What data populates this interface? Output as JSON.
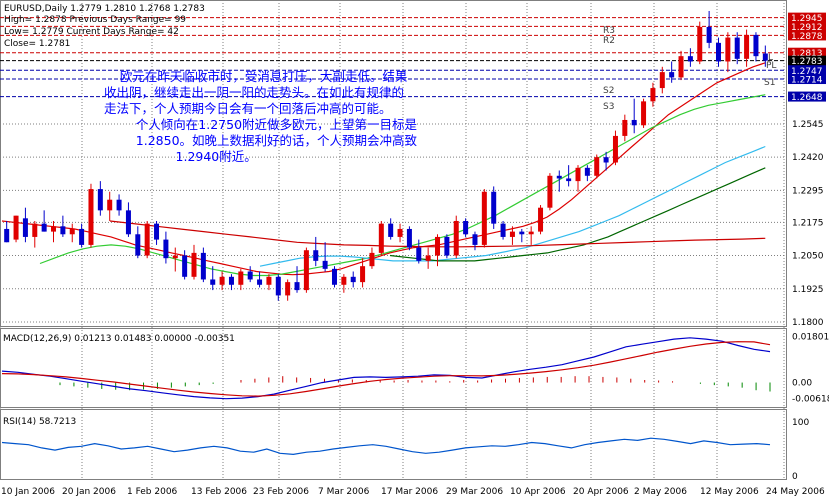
{
  "chart_data": [
    {
      "type": "candlestick",
      "title": "EURUSD,Daily  1.2779 1.2810 1.2768 1.2783",
      "info_lines": [
        "High= 1.2878     Previous Days Range= 99",
        "Low= 1.2779     Current Days Range= 42",
        "Close= 1.2781"
      ],
      "ylim": [
        1.18,
        1.3
      ],
      "y_ticks": [
        "1.2545",
        "1.2420",
        "1.2295",
        "1.2175",
        "1.2050",
        "1.1925",
        "1.1800"
      ],
      "x_ticks": [
        "10 Jan 2006",
        "20 Jan 2006",
        "1 Feb 2006",
        "13 Feb 2006",
        "23 Feb 2006",
        "7 Mar 2006",
        "17 Mar 2006",
        "29 Mar 2006",
        "10 Apr 2006",
        "20 Apr 2006",
        "2 May 2006",
        "12 May 2006",
        "24 May 2006"
      ],
      "candles": [
        [
          1.215,
          1.218,
          1.21,
          1.21
        ],
        [
          1.211,
          1.22,
          1.21,
          1.22
        ],
        [
          1.219,
          1.223,
          1.21,
          1.212
        ],
        [
          1.212,
          1.218,
          1.208,
          1.217
        ],
        [
          1.217,
          1.222,
          1.214,
          1.214
        ],
        [
          1.214,
          1.218,
          1.21,
          1.216
        ],
        [
          1.216,
          1.22,
          1.212,
          1.213
        ],
        [
          1.213,
          1.217,
          1.21,
          1.215
        ],
        [
          1.215,
          1.217,
          1.208,
          1.209
        ],
        [
          1.209,
          1.232,
          1.208,
          1.23
        ],
        [
          1.23,
          1.233,
          1.22,
          1.222
        ],
        [
          1.222,
          1.229,
          1.218,
          1.226
        ],
        [
          1.226,
          1.228,
          1.22,
          1.222
        ],
        [
          1.222,
          1.225,
          1.212,
          1.213
        ],
        [
          1.213,
          1.216,
          1.204,
          1.205
        ],
        [
          1.205,
          1.218,
          1.204,
          1.217
        ],
        [
          1.217,
          1.218,
          1.209,
          1.211
        ],
        [
          1.211,
          1.214,
          1.202,
          1.204
        ],
        [
          1.204,
          1.208,
          1.199,
          1.205
        ],
        [
          1.205,
          1.207,
          1.196,
          1.197
        ],
        [
          1.197,
          1.209,
          1.196,
          1.206
        ],
        [
          1.206,
          1.208,
          1.195,
          1.196
        ],
        [
          1.196,
          1.201,
          1.192,
          1.194
        ],
        [
          1.194,
          1.199,
          1.192,
          1.197
        ],
        [
          1.197,
          1.198,
          1.192,
          1.194
        ],
        [
          1.194,
          1.2,
          1.192,
          1.199
        ],
        [
          1.199,
          1.201,
          1.195,
          1.196
        ],
        [
          1.196,
          1.199,
          1.193,
          1.194
        ],
        [
          1.194,
          1.198,
          1.192,
          1.197
        ],
        [
          1.197,
          1.198,
          1.188,
          1.19
        ],
        [
          1.19,
          1.196,
          1.188,
          1.195
        ],
        [
          1.195,
          1.201,
          1.191,
          1.192
        ],
        [
          1.192,
          1.208,
          1.191,
          1.207
        ],
        [
          1.207,
          1.212,
          1.201,
          1.203
        ],
        [
          1.203,
          1.21,
          1.199,
          1.2
        ],
        [
          1.2,
          1.201,
          1.193,
          1.194
        ],
        [
          1.194,
          1.198,
          1.191,
          1.197
        ],
        [
          1.197,
          1.199,
          1.193,
          1.195
        ],
        [
          1.195,
          1.204,
          1.193,
          1.201
        ],
        [
          1.201,
          1.208,
          1.2,
          1.206
        ],
        [
          1.206,
          1.218,
          1.205,
          1.217
        ],
        [
          1.217,
          1.219,
          1.211,
          1.212
        ],
        [
          1.212,
          1.217,
          1.21,
          1.215
        ],
        [
          1.215,
          1.216,
          1.207,
          1.208
        ],
        [
          1.208,
          1.211,
          1.202,
          1.203
        ],
        [
          1.203,
          1.208,
          1.2,
          1.205
        ],
        [
          1.205,
          1.213,
          1.201,
          1.212
        ],
        [
          1.212,
          1.213,
          1.204,
          1.205
        ],
        [
          1.205,
          1.22,
          1.204,
          1.218
        ],
        [
          1.218,
          1.219,
          1.212,
          1.213
        ],
        [
          1.213,
          1.214,
          1.207,
          1.209
        ],
        [
          1.209,
          1.23,
          1.208,
          1.229
        ],
        [
          1.229,
          1.231,
          1.215,
          1.217
        ],
        [
          1.217,
          1.218,
          1.211,
          1.212
        ],
        [
          1.212,
          1.216,
          1.209,
          1.214
        ],
        [
          1.214,
          1.215,
          1.21,
          1.213
        ],
        [
          1.213,
          1.216,
          1.209,
          1.214
        ],
        [
          1.214,
          1.224,
          1.213,
          1.223
        ],
        [
          1.223,
          1.236,
          1.222,
          1.235
        ],
        [
          1.235,
          1.237,
          1.229,
          1.234
        ],
        [
          1.234,
          1.239,
          1.231,
          1.233
        ],
        [
          1.233,
          1.239,
          1.229,
          1.238
        ],
        [
          1.238,
          1.239,
          1.233,
          1.235
        ],
        [
          1.235,
          1.243,
          1.234,
          1.242
        ],
        [
          1.242,
          1.244,
          1.237,
          1.24
        ],
        [
          1.24,
          1.252,
          1.239,
          1.25
        ],
        [
          1.25,
          1.258,
          1.248,
          1.256
        ],
        [
          1.256,
          1.264,
          1.251,
          1.254
        ],
        [
          1.254,
          1.264,
          1.253,
          1.263
        ],
        [
          1.263,
          1.27,
          1.261,
          1.268
        ],
        [
          1.268,
          1.276,
          1.266,
          1.274
        ],
        [
          1.274,
          1.278,
          1.27,
          1.272
        ],
        [
          1.272,
          1.282,
          1.271,
          1.28
        ],
        [
          1.28,
          1.283,
          1.276,
          1.278
        ],
        [
          1.278,
          1.293,
          1.277,
          1.291
        ],
        [
          1.291,
          1.297,
          1.283,
          1.285
        ],
        [
          1.285,
          1.287,
          1.276,
          1.278
        ],
        [
          1.278,
          1.289,
          1.274,
          1.287
        ],
        [
          1.287,
          1.289,
          1.277,
          1.279
        ],
        [
          1.279,
          1.29,
          1.276,
          1.288
        ],
        [
          1.288,
          1.289,
          1.278,
          1.28
        ],
        [
          1.281,
          1.284,
          1.276,
          1.2783
        ]
      ],
      "support_resistance": [
        {
          "label": "1.2945",
          "value": 1.2945,
          "color": "#cc0000"
        },
        {
          "label": "1.2912",
          "value": 1.2912,
          "color": "#cc0000"
        },
        {
          "label": "1.2878",
          "value": 1.2878,
          "color": "#cc0000"
        },
        {
          "label": "1.2813",
          "value": 1.2813,
          "color": "#cc0000"
        },
        {
          "label": "1.2783",
          "value": 1.2783,
          "color": "#000000"
        },
        {
          "label": "1.2747",
          "value": 1.2747,
          "color": "#0000aa"
        },
        {
          "label": "1.2714",
          "value": 1.2714,
          "color": "#0000aa"
        },
        {
          "label": "1.2648",
          "value": 1.2648,
          "color": "#0000aa"
        }
      ],
      "level_labels": [
        "R3",
        "R2",
        "S2",
        "S3",
        "S1",
        "L",
        "PL"
      ],
      "ma_series": [
        {
          "color": "#dd0000",
          "values": [
            1.218,
            1.2175,
            1.217,
            1.2165,
            1.216,
            1.2155,
            1.215,
            1.214,
            1.213,
            1.212,
            1.2105,
            1.209,
            1.208,
            1.207,
            1.206,
            1.205,
            1.204,
            1.203,
            1.202,
            1.201,
            1.2,
            1.199,
            1.1985,
            1.198,
            1.1978,
            1.198,
            1.1985,
            1.199,
            1.2,
            1.2015,
            1.203,
            1.2045,
            1.206,
            1.207,
            1.208,
            1.2085,
            1.209,
            1.21,
            1.211,
            1.212,
            1.213,
            1.214,
            1.215,
            1.216,
            1.2175,
            1.2195,
            1.2225,
            1.226,
            1.23,
            1.234,
            1.238,
            1.242,
            1.246,
            1.25,
            1.254,
            1.258,
            1.261,
            1.264,
            1.267,
            1.27,
            1.272,
            1.274,
            1.276,
            1.2775
          ]
        },
        {
          "color": "#33cc33",
          "values": [
            1.202,
            1.204,
            1.206,
            1.2075,
            1.2085,
            1.209,
            1.2085,
            1.2075,
            1.206,
            1.2045,
            1.203,
            1.2015,
            1.2,
            1.199,
            1.198,
            1.1975,
            1.1975,
            1.198,
            1.199,
            1.2,
            1.201,
            1.202,
            1.203,
            1.204,
            1.2055,
            1.207,
            1.2085,
            1.21,
            1.2115,
            1.213,
            1.215,
            1.2175,
            1.22,
            1.223,
            1.226,
            1.229,
            1.232,
            1.235,
            1.238,
            1.241,
            1.244,
            1.247,
            1.25,
            1.253,
            1.2555,
            1.258,
            1.26,
            1.2615,
            1.2625,
            1.2635,
            1.2645,
            1.2655
          ]
        },
        {
          "color": "#33bbee",
          "values": [
            1.201,
            1.202,
            1.203,
            1.204,
            1.2045,
            1.2048,
            1.2048,
            1.2045,
            1.204,
            1.2035,
            1.203,
            1.203,
            1.203,
            1.203,
            1.2035,
            1.204,
            1.2045,
            1.205,
            1.206,
            1.207,
            1.208,
            1.2095,
            1.211,
            1.2125,
            1.214,
            1.216,
            1.218,
            1.22,
            1.2225,
            1.225,
            1.2275,
            1.23,
            1.2325,
            1.235,
            1.2375,
            1.24,
            1.242,
            1.244,
            1.246
          ]
        },
        {
          "color": "#006600",
          "values": [
            1.205,
            1.2045,
            1.204,
            1.2035,
            1.203,
            1.203,
            1.203,
            1.203,
            1.2035,
            1.204,
            1.2045,
            1.205,
            1.2055,
            1.206,
            1.207,
            1.208,
            1.209,
            1.2105,
            1.212,
            1.214,
            1.216,
            1.218,
            1.22,
            1.222,
            1.224,
            1.226,
            1.228,
            1.23,
            1.232,
            1.234,
            1.236,
            1.238
          ]
        },
        {
          "color": "#cc0000",
          "values": [
            1.218,
            1.217,
            1.216,
            1.215,
            1.214,
            1.213,
            1.212,
            1.211,
            1.21,
            1.2095,
            1.209,
            1.2088,
            1.2085,
            1.2084,
            1.2083,
            1.2083,
            1.2084,
            1.2085,
            1.2087,
            1.209,
            1.2093,
            1.2096,
            1.2099,
            1.2102,
            1.2105,
            1.2108,
            1.211,
            1.2112,
            1.2115
          ]
        }
      ]
    },
    {
      "type": "macd",
      "label": "MACD(12,26,9) 0.01213 0.01483 0.00000 -0.00351",
      "ylim": [
        -0.008,
        0.019
      ],
      "y_ticks": [
        "0.01801",
        "0.00",
        "-0.00618"
      ],
      "macd": [
        0.0045,
        0.004,
        0.0032,
        0.0025,
        0.0015,
        0.0005,
        -0.0005,
        -0.0015,
        -0.0025,
        -0.0032,
        -0.004,
        -0.0048,
        -0.0055,
        -0.006,
        -0.0063,
        -0.0061,
        -0.0055,
        -0.0045,
        -0.003,
        -0.0015,
        0.0,
        0.001,
        0.002,
        0.0022,
        0.002,
        0.0022,
        0.0025,
        0.003,
        0.0028,
        0.002,
        0.0018,
        0.003,
        0.0042,
        0.0052,
        0.006,
        0.007,
        0.0085,
        0.01,
        0.012,
        0.014,
        0.015,
        0.016,
        0.017,
        0.0175,
        0.017,
        0.0162,
        0.0145,
        0.013,
        0.0121
      ],
      "signal": [
        0.0035,
        0.0034,
        0.0031,
        0.0027,
        0.0022,
        0.0016,
        0.0009,
        0.0002,
        -0.0006,
        -0.0014,
        -0.0022,
        -0.003,
        -0.0037,
        -0.0043,
        -0.0048,
        -0.0052,
        -0.0053,
        -0.005,
        -0.0044,
        -0.0035,
        -0.0025,
        -0.0014,
        -0.0004,
        0.0005,
        0.0012,
        0.0017,
        0.0021,
        0.0025,
        0.0027,
        0.0027,
        0.0026,
        0.0028,
        0.0032,
        0.0037,
        0.0043,
        0.005,
        0.0058,
        0.0068,
        0.008,
        0.0093,
        0.0106,
        0.0119,
        0.0131,
        0.0142,
        0.0151,
        0.0157,
        0.016,
        0.0159,
        0.0148
      ],
      "histogram": [
        -0.001,
        -0.0015,
        -0.002,
        -0.0025,
        -0.0028,
        -0.003,
        -0.0027,
        -0.0025,
        -0.002,
        -0.0015,
        -0.001,
        -0.0005,
        0.0,
        0.001,
        0.0015,
        0.002,
        0.0025,
        0.002,
        0.0018,
        0.0015,
        0.0012,
        0.0012,
        0.001,
        0.001,
        0.0008,
        0.001,
        0.0008,
        0.0008,
        0.0005,
        0.001,
        0.0008,
        0.0012,
        0.0015,
        0.0018,
        0.002,
        0.0022,
        0.0022,
        0.0025,
        0.0025,
        0.0022,
        0.002,
        0.0015,
        0.001,
        0.0008,
        0.0005,
        0.0,
        -0.0005,
        -0.001,
        -0.0015,
        -0.002,
        -0.003,
        -0.0035
      ]
    },
    {
      "type": "line",
      "label": "RSI(14) 58.7213",
      "ylim": [
        0,
        100
      ],
      "y_ticks": [
        "100",
        "0"
      ],
      "values": [
        62,
        60,
        58,
        52,
        48,
        53,
        55,
        60,
        56,
        50,
        52,
        55,
        50,
        45,
        48,
        52,
        55,
        52,
        46,
        44,
        50,
        42,
        40,
        44,
        46,
        50,
        53,
        56,
        58,
        55,
        50,
        45,
        42,
        44,
        48,
        52,
        54,
        56,
        55,
        58,
        62,
        60,
        56,
        52,
        58,
        62,
        65,
        68,
        66,
        70,
        68,
        64,
        60,
        65,
        62,
        58,
        59,
        60,
        58
      ]
    }
  ],
  "annotation_lines": [
    "    欧元在昨天临收市时，受消息打压，大副走低。结果",
    "收出阴，继续走出一阴一阳的走势头。在如此有规律的",
    "走法下，个人预期今日会有一个回落后冲高的可能。",
    "        个人倾向在1.2750附近做多欧元，上望第一目标是",
    "        1.2850。如晚上数据利好的话，个人预期会冲高致",
    "                  1.2940附近。"
  ],
  "colors": {
    "bull": "#e00000",
    "bear": "#0000cc",
    "grid": "#7f7f7f",
    "annotation": "#0000ff"
  }
}
